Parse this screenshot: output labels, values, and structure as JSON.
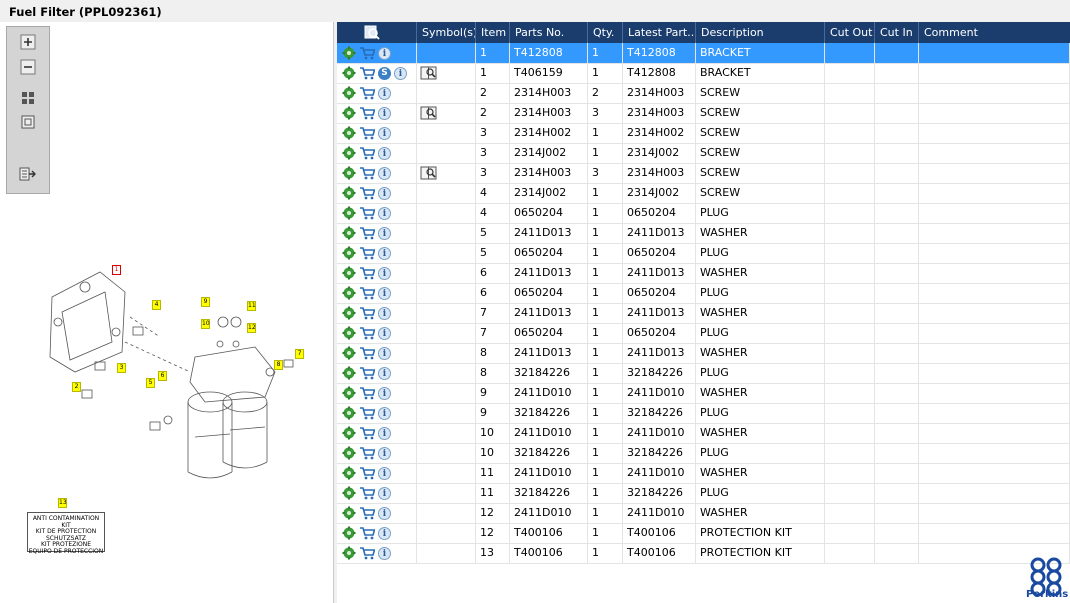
{
  "window": {
    "title": "Fuel Filter (PPL092361)"
  },
  "colors": {
    "header_bg": "#1a3d6e",
    "selected_bg": "#3399ff",
    "tag_yellow": "#ffff00",
    "brand_blue": "#1a4aa0"
  },
  "toolbar": {
    "zoom_in": "zoom-in-icon",
    "zoom_out": "zoom-out-icon",
    "fit": "fit-icon",
    "actual": "actual-size-icon",
    "export": "export-icon"
  },
  "drawing": {
    "callouts": [
      "1",
      "2",
      "3",
      "4",
      "5",
      "6",
      "7",
      "8",
      "9",
      "10",
      "11",
      "12",
      "13"
    ],
    "kit_lines": [
      "ANTI CONTAMINATION KIT",
      "KIT DE PROTECTION",
      "SCHUTZSATZ",
      "KIT PROTEZIONE",
      "EQUIPO DE PROTECCION"
    ]
  },
  "grid": {
    "headers": {
      "symbols": "Symbol(s)",
      "item": "Item",
      "parts_no": "Parts No.",
      "qty": "Qty.",
      "latest": "Latest Part...",
      "description": "Description",
      "cut_out": "Cut Out",
      "cut_in": "Cut In",
      "comment": "Comment"
    },
    "rows": [
      {
        "item": "1",
        "part": "T412808",
        "qty": "1",
        "latest": "T412808",
        "desc": "BRACKET",
        "s": false,
        "book": false
      },
      {
        "item": "1",
        "part": "T406159",
        "qty": "1",
        "latest": "T412808",
        "desc": "BRACKET",
        "s": true,
        "book": true
      },
      {
        "item": "2",
        "part": "2314H003",
        "qty": "2",
        "latest": "2314H003",
        "desc": "SCREW",
        "s": false,
        "book": false
      },
      {
        "item": "2",
        "part": "2314H003",
        "qty": "3",
        "latest": "2314H003",
        "desc": "SCREW",
        "s": false,
        "book": true
      },
      {
        "item": "3",
        "part": "2314H002",
        "qty": "1",
        "latest": "2314H002",
        "desc": "SCREW",
        "s": false,
        "book": false
      },
      {
        "item": "3",
        "part": "2314J002",
        "qty": "1",
        "latest": "2314J002",
        "desc": "SCREW",
        "s": false,
        "book": false
      },
      {
        "item": "3",
        "part": "2314H003",
        "qty": "3",
        "latest": "2314H003",
        "desc": "SCREW",
        "s": false,
        "book": true
      },
      {
        "item": "4",
        "part": "2314J002",
        "qty": "1",
        "latest": "2314J002",
        "desc": "SCREW",
        "s": false,
        "book": false
      },
      {
        "item": "4",
        "part": "0650204",
        "qty": "1",
        "latest": "0650204",
        "desc": "PLUG",
        "s": false,
        "book": false
      },
      {
        "item": "5",
        "part": "2411D013",
        "qty": "1",
        "latest": "2411D013",
        "desc": "WASHER",
        "s": false,
        "book": false
      },
      {
        "item": "5",
        "part": "0650204",
        "qty": "1",
        "latest": "0650204",
        "desc": "PLUG",
        "s": false,
        "book": false
      },
      {
        "item": "6",
        "part": "2411D013",
        "qty": "1",
        "latest": "2411D013",
        "desc": "WASHER",
        "s": false,
        "book": false
      },
      {
        "item": "6",
        "part": "0650204",
        "qty": "1",
        "latest": "0650204",
        "desc": "PLUG",
        "s": false,
        "book": false
      },
      {
        "item": "7",
        "part": "2411D013",
        "qty": "1",
        "latest": "2411D013",
        "desc": "WASHER",
        "s": false,
        "book": false
      },
      {
        "item": "7",
        "part": "0650204",
        "qty": "1",
        "latest": "0650204",
        "desc": "PLUG",
        "s": false,
        "book": false
      },
      {
        "item": "8",
        "part": "2411D013",
        "qty": "1",
        "latest": "2411D013",
        "desc": "WASHER",
        "s": false,
        "book": false
      },
      {
        "item": "8",
        "part": "32184226",
        "qty": "1",
        "latest": "32184226",
        "desc": "PLUG",
        "s": false,
        "book": false
      },
      {
        "item": "9",
        "part": "2411D010",
        "qty": "1",
        "latest": "2411D010",
        "desc": "WASHER",
        "s": false,
        "book": false
      },
      {
        "item": "9",
        "part": "32184226",
        "qty": "1",
        "latest": "32184226",
        "desc": "PLUG",
        "s": false,
        "book": false
      },
      {
        "item": "10",
        "part": "2411D010",
        "qty": "1",
        "latest": "2411D010",
        "desc": "WASHER",
        "s": false,
        "book": false
      },
      {
        "item": "10",
        "part": "32184226",
        "qty": "1",
        "latest": "32184226",
        "desc": "PLUG",
        "s": false,
        "book": false
      },
      {
        "item": "11",
        "part": "2411D010",
        "qty": "1",
        "latest": "2411D010",
        "desc": "WASHER",
        "s": false,
        "book": false
      },
      {
        "item": "11",
        "part": "32184226",
        "qty": "1",
        "latest": "32184226",
        "desc": "PLUG",
        "s": false,
        "book": false
      },
      {
        "item": "12",
        "part": "2411D010",
        "qty": "1",
        "latest": "2411D010",
        "desc": "WASHER",
        "s": false,
        "book": false
      },
      {
        "item": "12",
        "part": "T400106",
        "qty": "1",
        "latest": "T400106",
        "desc": "PROTECTION KIT",
        "s": false,
        "book": false
      },
      {
        "item": "13",
        "part": "T400106",
        "qty": "1",
        "latest": "T400106",
        "desc": "PROTECTION KIT",
        "s": false,
        "book": false
      }
    ],
    "selected_index": 0
  },
  "brand": {
    "name": "Perkins"
  }
}
